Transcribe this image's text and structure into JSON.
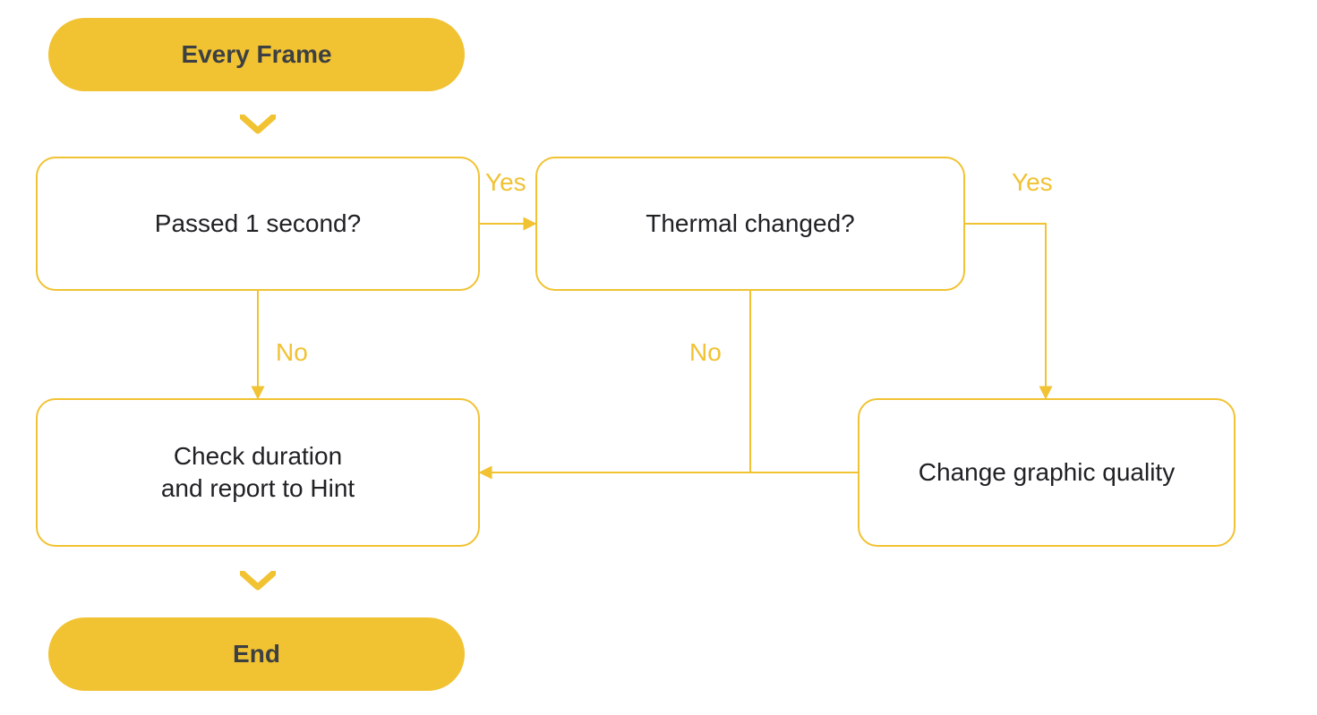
{
  "colors": {
    "accent": "#f1c232",
    "text_dark": "#3c4043",
    "text_body": "#202124"
  },
  "nodes": {
    "start": {
      "label": "Every Frame"
    },
    "passed1s": {
      "label": "Passed 1 second?"
    },
    "thermal": {
      "label": "Thermal changed?"
    },
    "checkdur": {
      "label_line1": "Check duration",
      "label_line2": "and report to Hint"
    },
    "changeq": {
      "label": "Change graphic quality"
    },
    "end": {
      "label": "End"
    }
  },
  "edges": {
    "passed1s_yes": "Yes",
    "passed1s_no": "No",
    "thermal_yes": "Yes",
    "thermal_no": "No"
  }
}
